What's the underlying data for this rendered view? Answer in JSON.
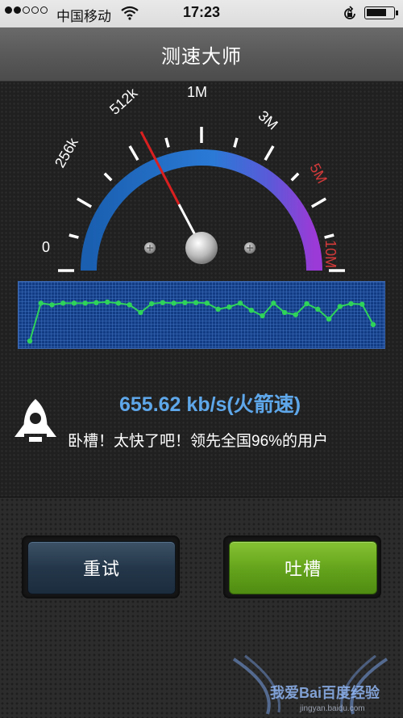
{
  "status_bar": {
    "carrier": "中国移动",
    "time": "17:23",
    "signal_bars_filled": 2,
    "signal_bars_total": 5,
    "icons": [
      "signal-dots-icon",
      "wifi-icon",
      "rotation-lock-icon",
      "battery-icon"
    ]
  },
  "nav": {
    "title": "测速大师"
  },
  "gauge": {
    "scale_labels": [
      "0",
      "256k",
      "512k",
      "1M",
      "3M",
      "5M",
      "10M"
    ],
    "needle_reading": "512k",
    "colors": {
      "arc_start": "#1a5fb0",
      "arc_end": "#9b3ad6",
      "needle": "#d92020",
      "warning_labels": "#d43a3a"
    }
  },
  "graph": {
    "points": [
      0.04,
      0.73,
      0.7,
      0.73,
      0.73,
      0.73,
      0.74,
      0.75,
      0.73,
      0.7,
      0.56,
      0.72,
      0.74,
      0.73,
      0.74,
      0.74,
      0.73,
      0.62,
      0.66,
      0.73,
      0.6,
      0.5,
      0.73,
      0.56,
      0.52,
      0.72,
      0.62,
      0.44,
      0.67,
      0.72,
      0.71,
      0.34
    ],
    "line_color": "#2fd35a"
  },
  "result": {
    "speed_text": "655.62 kb/s(火箭速)",
    "message": "卧槽！太快了吧！领先全国96%的用户",
    "icon": "rocket-icon"
  },
  "buttons": {
    "retry": "重试",
    "complain": "吐槽"
  },
  "watermark": {
    "text": "我爱Bai百度经验",
    "url": "jingyan.baidu.com"
  }
}
